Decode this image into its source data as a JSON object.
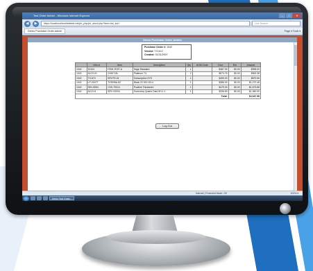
{
  "browser": {
    "title": "Test Order Admin - Windows Internet Explorer",
    "url": "https://localhost/test/testtest.net/pb_php/pb_store.php?item=list_sort",
    "search_placeholder": "Live Search",
    "tab_label": "Demo Purchase Order admin",
    "toolbar_right": "Page ▾  Tools ▾"
  },
  "page": {
    "header": "Demo Purchase Order Admin",
    "order": {
      "number_label": "Purchase Order #:",
      "number_value": "1042",
      "vendor_label": "Vendor:",
      "vendor_value": "T.S.M.C",
      "created_label": "Created:",
      "created_value": "01/31/2007"
    },
    "table": {
      "headers": [
        "",
        "Vdrn #",
        "Item",
        "Description",
        "Qty",
        "UOM Code",
        "Cost",
        "Ext",
        "Amount"
      ],
      "rows": [
        [
          "1042",
          "10104",
          "ITEM-TEST-A",
          "Sage Standard",
          "1",
          "",
          "$487.00",
          "$0.00",
          "$998.00"
        ],
        [
          "1042",
          "A1C0-01",
          "CHKIT-BL",
          "Platinum 74",
          "2",
          "",
          "$573.76",
          "$0.00",
          "$963.38"
        ],
        [
          "1042",
          "TS-870",
          "SRVTR-04",
          "Subscription SYS",
          "1",
          "",
          "$499.00",
          "$0.00",
          "$879.55"
        ],
        [
          "1042",
          "UT-00477",
          "TOSHBA-82",
          "Black 22 SIG-S3-4",
          "1",
          "",
          "$386.00",
          "$0.00",
          "$1,272.48"
        ],
        [
          "1042",
          "SEV-5554",
          "CSS-T0014",
          "Positive Thickened",
          "1",
          "",
          "$479.00",
          "$0.00",
          "$1,573.88"
        ],
        [
          "1042",
          "A1C0-8",
          "SRV-V0004",
          "Sustronoy Quartz Dark 5H-1.1",
          "1",
          "",
          "$336.69",
          "$0.00",
          "$1,360.00"
        ]
      ],
      "total_label": "Total:",
      "total_value": "$4,347.98"
    },
    "logout_label": "Log Out"
  },
  "statusbar": {
    "zone": "Internet | Protected Mode: Off",
    "zoom": "100% ▾"
  },
  "taskbar": {
    "app_label": "Demo Test Order..."
  },
  "colors": {
    "page_background": "#c2502f",
    "header_bar": "#8ea7c4"
  }
}
